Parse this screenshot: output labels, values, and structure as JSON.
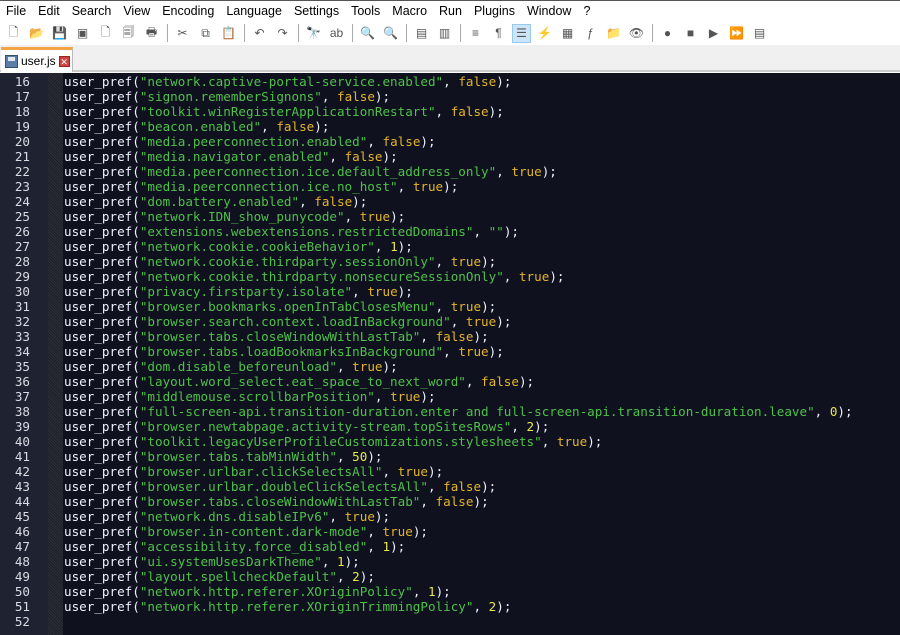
{
  "menu": [
    "File",
    "Edit",
    "Search",
    "View",
    "Encoding",
    "Language",
    "Settings",
    "Tools",
    "Macro",
    "Run",
    "Plugins",
    "Window",
    "?"
  ],
  "toolbar": [
    {
      "icon": "new-file-icon",
      "g": "🗋"
    },
    {
      "icon": "open-file-icon",
      "g": "📂"
    },
    {
      "icon": "save-icon",
      "g": "💾"
    },
    {
      "icon": "save-all-icon",
      "g": "▣"
    },
    {
      "icon": "close-file-icon",
      "g": "🗋"
    },
    {
      "icon": "close-all-icon",
      "g": "🗐"
    },
    {
      "icon": "print-icon",
      "g": "🖶"
    },
    {
      "sep": true
    },
    {
      "icon": "cut-icon",
      "g": "✂"
    },
    {
      "icon": "copy-icon",
      "g": "⧉"
    },
    {
      "icon": "paste-icon",
      "g": "📋"
    },
    {
      "sep": true
    },
    {
      "icon": "undo-icon",
      "g": "↶"
    },
    {
      "icon": "redo-icon",
      "g": "↷"
    },
    {
      "sep": true
    },
    {
      "icon": "find-icon",
      "g": "🔭"
    },
    {
      "icon": "replace-icon",
      "g": "ab"
    },
    {
      "sep": true
    },
    {
      "icon": "zoom-in-icon",
      "g": "🔍"
    },
    {
      "icon": "zoom-out-icon",
      "g": "🔍"
    },
    {
      "sep": true
    },
    {
      "icon": "sync-vertical-icon",
      "g": "▤"
    },
    {
      "icon": "sync-horizontal-icon",
      "g": "▥"
    },
    {
      "sep": true
    },
    {
      "icon": "word-wrap-icon",
      "g": "≡"
    },
    {
      "icon": "show-all-chars-icon",
      "g": "¶"
    },
    {
      "icon": "indent-guide-icon",
      "g": "☰",
      "active": true
    },
    {
      "icon": "udl-icon",
      "g": "⚡"
    },
    {
      "icon": "doc-map-icon",
      "g": "▦"
    },
    {
      "icon": "function-list-icon",
      "g": "ƒ"
    },
    {
      "icon": "folder-workspace-icon",
      "g": "📁"
    },
    {
      "icon": "monitoring-icon",
      "g": "👁"
    },
    {
      "sep": true
    },
    {
      "icon": "record-macro-icon",
      "g": "●"
    },
    {
      "icon": "stop-macro-icon",
      "g": "■"
    },
    {
      "icon": "play-macro-icon",
      "g": "▶"
    },
    {
      "icon": "run-macro-multiple-icon",
      "g": "⏩"
    },
    {
      "icon": "save-macro-icon",
      "g": "▤"
    }
  ],
  "tab": {
    "label": "user.js"
  },
  "lines": [
    {
      "n": "16",
      "key": "\"network.captive-portal-service.enabled\"",
      "val": "false",
      "t": "k"
    },
    {
      "n": "17",
      "key": "\"signon.rememberSignons\"",
      "val": "false",
      "t": "k"
    },
    {
      "n": "18",
      "key": "\"toolkit.winRegisterApplicationRestart\"",
      "val": "false",
      "t": "k"
    },
    {
      "n": "19",
      "key": "\"beacon.enabled\"",
      "val": "false",
      "t": "k"
    },
    {
      "n": "20",
      "key": "\"media.peerconnection.enabled\"",
      "val": "false",
      "t": "k"
    },
    {
      "n": "21",
      "key": "\"media.navigator.enabled\"",
      "val": "false",
      "t": "k"
    },
    {
      "n": "22",
      "key": "\"media.peerconnection.ice.default_address_only\"",
      "val": "true",
      "t": "k"
    },
    {
      "n": "23",
      "key": "\"media.peerconnection.ice.no_host\"",
      "val": "true",
      "t": "k"
    },
    {
      "n": "24",
      "key": "\"dom.battery.enabled\"",
      "val": "false",
      "t": "k"
    },
    {
      "n": "25",
      "key": "\"network.IDN_show_punycode\"",
      "val": "true",
      "t": "k"
    },
    {
      "n": "26",
      "key": "\"extensions.webextensions.restrictedDomains\"",
      "val": "\"\"",
      "t": "s"
    },
    {
      "n": "27",
      "key": "\"network.cookie.cookieBehavior\"",
      "val": "1",
      "t": "n"
    },
    {
      "n": "28",
      "key": "\"network.cookie.thirdparty.sessionOnly\"",
      "val": "true",
      "t": "k"
    },
    {
      "n": "29",
      "key": "\"network.cookie.thirdparty.nonsecureSessionOnly\"",
      "val": "true",
      "t": "k"
    },
    {
      "n": "30",
      "key": "\"privacy.firstparty.isolate\"",
      "val": "true",
      "t": "k"
    },
    {
      "n": "31",
      "key": "\"browser.bookmarks.openInTabClosesMenu\"",
      "val": "true",
      "t": "k"
    },
    {
      "n": "32",
      "key": "\"browser.search.context.loadInBackground\"",
      "val": "true",
      "t": "k"
    },
    {
      "n": "33",
      "key": "\"browser.tabs.closeWindowWithLastTab\"",
      "val": "false",
      "t": "k"
    },
    {
      "n": "34",
      "key": "\"browser.tabs.loadBookmarksInBackground\"",
      "val": "true",
      "t": "k"
    },
    {
      "n": "35",
      "key": "\"dom.disable_beforeunload\"",
      "val": "true",
      "t": "k"
    },
    {
      "n": "36",
      "key": "\"layout.word_select.eat_space_to_next_word\"",
      "val": "false",
      "t": "k"
    },
    {
      "n": "37",
      "key": "\"middlemouse.scrollbarPosition\"",
      "val": "true",
      "t": "k"
    },
    {
      "n": "38",
      "key": "\"full-screen-api.transition-duration.enter and full-screen-api.transition-duration.leave\"",
      "val": "0",
      "t": "n"
    },
    {
      "n": "39",
      "key": "\"browser.newtabpage.activity-stream.topSitesRows\"",
      "val": "2",
      "t": "n"
    },
    {
      "n": "40",
      "key": "\"toolkit.legacyUserProfileCustomizations.stylesheets\"",
      "val": "true",
      "t": "k"
    },
    {
      "n": "41",
      "key": "\"browser.tabs.tabMinWidth\"",
      "val": "50",
      "t": "n"
    },
    {
      "n": "42",
      "key": "\"browser.urlbar.clickSelectsAll\"",
      "val": "true",
      "t": "k"
    },
    {
      "n": "43",
      "key": "\"browser.urlbar.doubleClickSelectsAll\"",
      "val": "false",
      "t": "k"
    },
    {
      "n": "44",
      "key": "\"browser.tabs.closeWindowWithLastTab\"",
      "val": "false",
      "t": "k"
    },
    {
      "n": "45",
      "key": "\"network.dns.disableIPv6\"",
      "val": "true",
      "t": "k"
    },
    {
      "n": "46",
      "key": "\"browser.in-content.dark-mode\"",
      "val": "true",
      "t": "k"
    },
    {
      "n": "47",
      "key": "\"accessibility.force_disabled\"",
      "val": "1",
      "t": "n"
    },
    {
      "n": "48",
      "key": "\"ui.systemUsesDarkTheme\"",
      "val": "1",
      "t": "n"
    },
    {
      "n": "49",
      "key": "\"layout.spellcheckDefault\"",
      "val": "2",
      "t": "n"
    },
    {
      "n": "50",
      "key": "\"network.http.referer.XOriginPolicy\"",
      "val": "1",
      "t": "n"
    },
    {
      "n": "51",
      "key": "\"network.http.referer.XOriginTrimmingPolicy\"",
      "val": "2",
      "t": "n"
    },
    {
      "n": "52",
      "key": "",
      "val": "",
      "t": ""
    }
  ],
  "syntax": {
    "fn": "user_pref",
    "open": "(",
    "sep": ", ",
    "close": ");"
  }
}
